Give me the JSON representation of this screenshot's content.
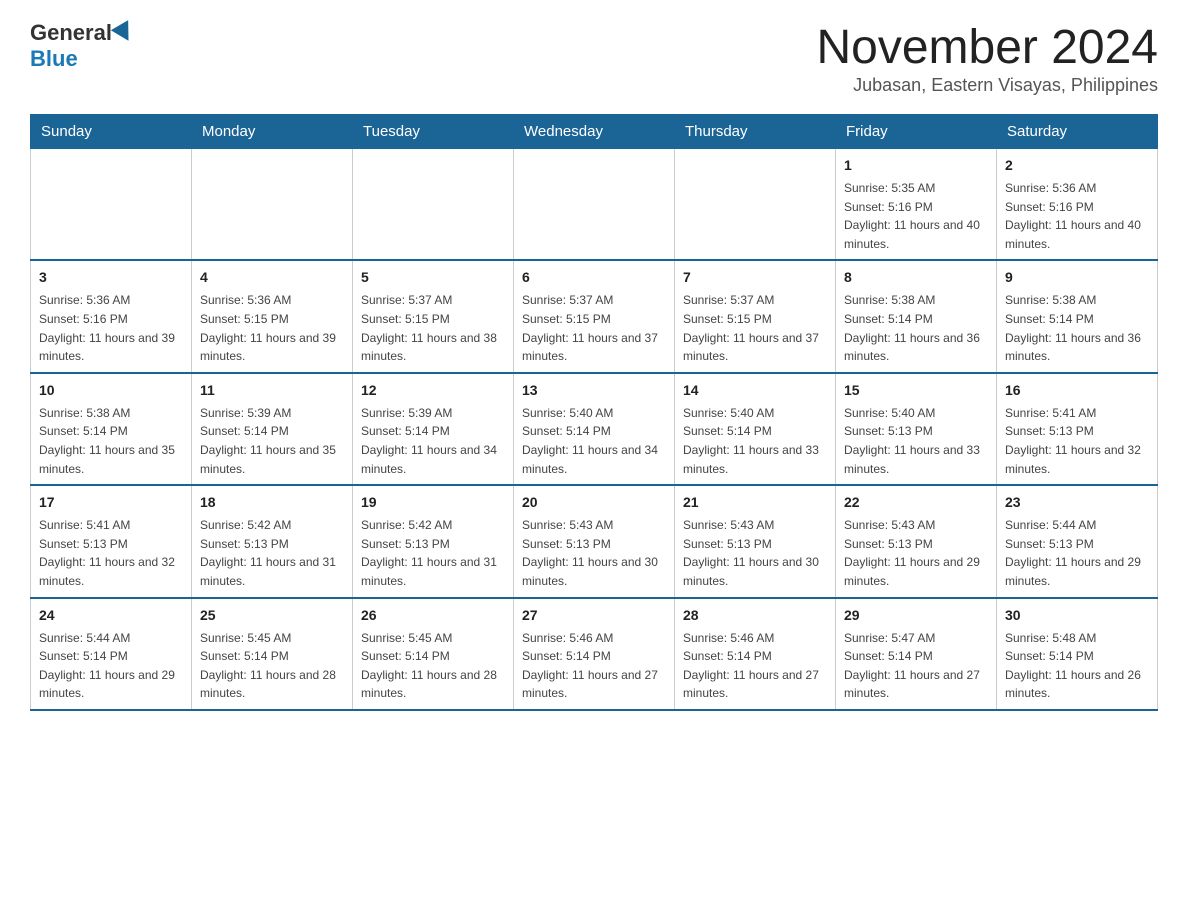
{
  "header": {
    "logo_general": "General",
    "logo_blue": "Blue",
    "month_title": "November 2024",
    "subtitle": "Jubasan, Eastern Visayas, Philippines"
  },
  "weekdays": [
    "Sunday",
    "Monday",
    "Tuesday",
    "Wednesday",
    "Thursday",
    "Friday",
    "Saturday"
  ],
  "weeks": [
    [
      {
        "day": "",
        "sunrise": "",
        "sunset": "",
        "daylight": ""
      },
      {
        "day": "",
        "sunrise": "",
        "sunset": "",
        "daylight": ""
      },
      {
        "day": "",
        "sunrise": "",
        "sunset": "",
        "daylight": ""
      },
      {
        "day": "",
        "sunrise": "",
        "sunset": "",
        "daylight": ""
      },
      {
        "day": "",
        "sunrise": "",
        "sunset": "",
        "daylight": ""
      },
      {
        "day": "1",
        "sunrise": "Sunrise: 5:35 AM",
        "sunset": "Sunset: 5:16 PM",
        "daylight": "Daylight: 11 hours and 40 minutes."
      },
      {
        "day": "2",
        "sunrise": "Sunrise: 5:36 AM",
        "sunset": "Sunset: 5:16 PM",
        "daylight": "Daylight: 11 hours and 40 minutes."
      }
    ],
    [
      {
        "day": "3",
        "sunrise": "Sunrise: 5:36 AM",
        "sunset": "Sunset: 5:16 PM",
        "daylight": "Daylight: 11 hours and 39 minutes."
      },
      {
        "day": "4",
        "sunrise": "Sunrise: 5:36 AM",
        "sunset": "Sunset: 5:15 PM",
        "daylight": "Daylight: 11 hours and 39 minutes."
      },
      {
        "day": "5",
        "sunrise": "Sunrise: 5:37 AM",
        "sunset": "Sunset: 5:15 PM",
        "daylight": "Daylight: 11 hours and 38 minutes."
      },
      {
        "day": "6",
        "sunrise": "Sunrise: 5:37 AM",
        "sunset": "Sunset: 5:15 PM",
        "daylight": "Daylight: 11 hours and 37 minutes."
      },
      {
        "day": "7",
        "sunrise": "Sunrise: 5:37 AM",
        "sunset": "Sunset: 5:15 PM",
        "daylight": "Daylight: 11 hours and 37 minutes."
      },
      {
        "day": "8",
        "sunrise": "Sunrise: 5:38 AM",
        "sunset": "Sunset: 5:14 PM",
        "daylight": "Daylight: 11 hours and 36 minutes."
      },
      {
        "day": "9",
        "sunrise": "Sunrise: 5:38 AM",
        "sunset": "Sunset: 5:14 PM",
        "daylight": "Daylight: 11 hours and 36 minutes."
      }
    ],
    [
      {
        "day": "10",
        "sunrise": "Sunrise: 5:38 AM",
        "sunset": "Sunset: 5:14 PM",
        "daylight": "Daylight: 11 hours and 35 minutes."
      },
      {
        "day": "11",
        "sunrise": "Sunrise: 5:39 AM",
        "sunset": "Sunset: 5:14 PM",
        "daylight": "Daylight: 11 hours and 35 minutes."
      },
      {
        "day": "12",
        "sunrise": "Sunrise: 5:39 AM",
        "sunset": "Sunset: 5:14 PM",
        "daylight": "Daylight: 11 hours and 34 minutes."
      },
      {
        "day": "13",
        "sunrise": "Sunrise: 5:40 AM",
        "sunset": "Sunset: 5:14 PM",
        "daylight": "Daylight: 11 hours and 34 minutes."
      },
      {
        "day": "14",
        "sunrise": "Sunrise: 5:40 AM",
        "sunset": "Sunset: 5:14 PM",
        "daylight": "Daylight: 11 hours and 33 minutes."
      },
      {
        "day": "15",
        "sunrise": "Sunrise: 5:40 AM",
        "sunset": "Sunset: 5:13 PM",
        "daylight": "Daylight: 11 hours and 33 minutes."
      },
      {
        "day": "16",
        "sunrise": "Sunrise: 5:41 AM",
        "sunset": "Sunset: 5:13 PM",
        "daylight": "Daylight: 11 hours and 32 minutes."
      }
    ],
    [
      {
        "day": "17",
        "sunrise": "Sunrise: 5:41 AM",
        "sunset": "Sunset: 5:13 PM",
        "daylight": "Daylight: 11 hours and 32 minutes."
      },
      {
        "day": "18",
        "sunrise": "Sunrise: 5:42 AM",
        "sunset": "Sunset: 5:13 PM",
        "daylight": "Daylight: 11 hours and 31 minutes."
      },
      {
        "day": "19",
        "sunrise": "Sunrise: 5:42 AM",
        "sunset": "Sunset: 5:13 PM",
        "daylight": "Daylight: 11 hours and 31 minutes."
      },
      {
        "day": "20",
        "sunrise": "Sunrise: 5:43 AM",
        "sunset": "Sunset: 5:13 PM",
        "daylight": "Daylight: 11 hours and 30 minutes."
      },
      {
        "day": "21",
        "sunrise": "Sunrise: 5:43 AM",
        "sunset": "Sunset: 5:13 PM",
        "daylight": "Daylight: 11 hours and 30 minutes."
      },
      {
        "day": "22",
        "sunrise": "Sunrise: 5:43 AM",
        "sunset": "Sunset: 5:13 PM",
        "daylight": "Daylight: 11 hours and 29 minutes."
      },
      {
        "day": "23",
        "sunrise": "Sunrise: 5:44 AM",
        "sunset": "Sunset: 5:13 PM",
        "daylight": "Daylight: 11 hours and 29 minutes."
      }
    ],
    [
      {
        "day": "24",
        "sunrise": "Sunrise: 5:44 AM",
        "sunset": "Sunset: 5:14 PM",
        "daylight": "Daylight: 11 hours and 29 minutes."
      },
      {
        "day": "25",
        "sunrise": "Sunrise: 5:45 AM",
        "sunset": "Sunset: 5:14 PM",
        "daylight": "Daylight: 11 hours and 28 minutes."
      },
      {
        "day": "26",
        "sunrise": "Sunrise: 5:45 AM",
        "sunset": "Sunset: 5:14 PM",
        "daylight": "Daylight: 11 hours and 28 minutes."
      },
      {
        "day": "27",
        "sunrise": "Sunrise: 5:46 AM",
        "sunset": "Sunset: 5:14 PM",
        "daylight": "Daylight: 11 hours and 27 minutes."
      },
      {
        "day": "28",
        "sunrise": "Sunrise: 5:46 AM",
        "sunset": "Sunset: 5:14 PM",
        "daylight": "Daylight: 11 hours and 27 minutes."
      },
      {
        "day": "29",
        "sunrise": "Sunrise: 5:47 AM",
        "sunset": "Sunset: 5:14 PM",
        "daylight": "Daylight: 11 hours and 27 minutes."
      },
      {
        "day": "30",
        "sunrise": "Sunrise: 5:48 AM",
        "sunset": "Sunset: 5:14 PM",
        "daylight": "Daylight: 11 hours and 26 minutes."
      }
    ]
  ]
}
